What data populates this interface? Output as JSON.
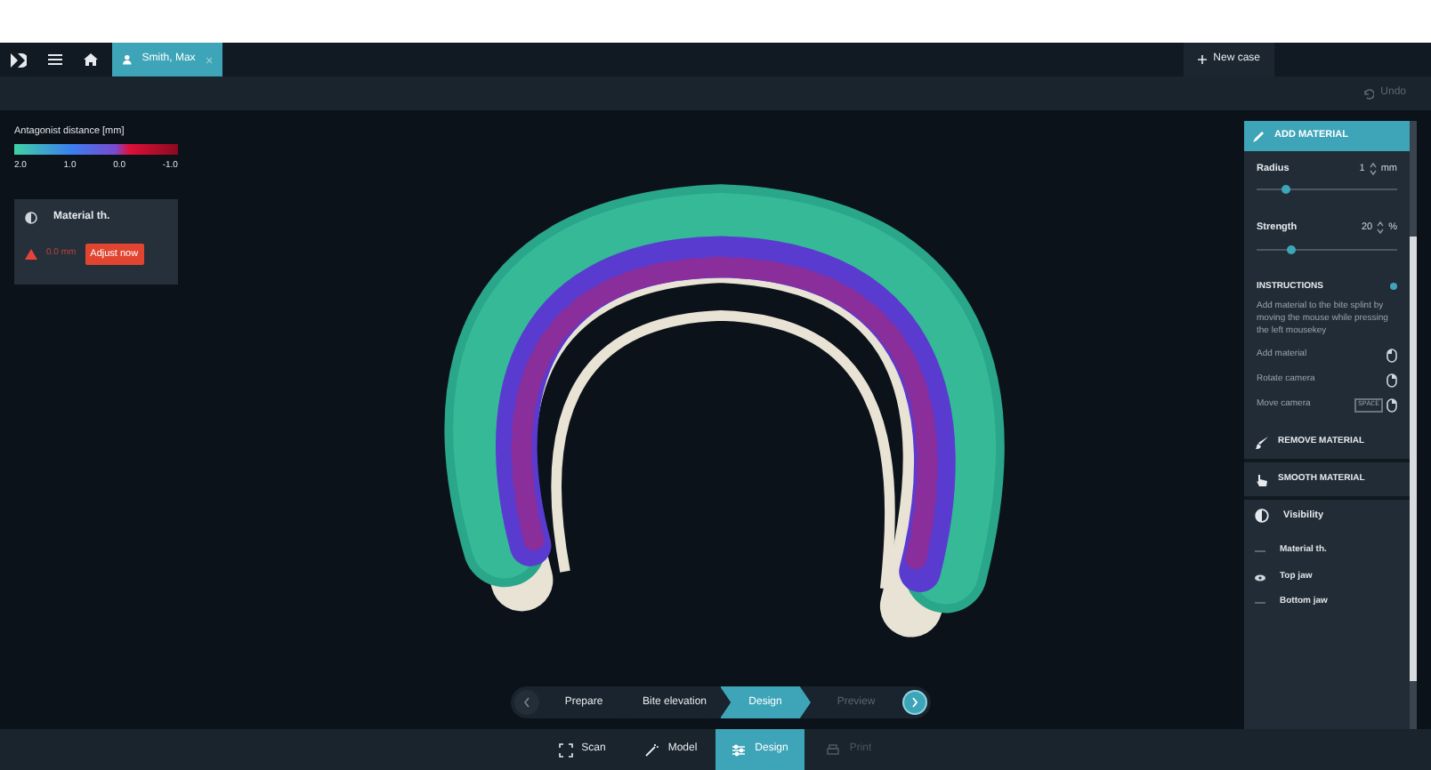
{
  "topbar": {
    "tabs": [
      {
        "label": "Smith, Max",
        "selected": true
      }
    ],
    "new_case": "New case"
  },
  "subbar": {
    "undo": {
      "label": "Undo",
      "disabled": true
    }
  },
  "legend": {
    "title": "Antagonist distance [mm]",
    "ticks": [
      "2.0",
      "1.0",
      "0.0",
      "-1.0"
    ]
  },
  "material_panel": {
    "title": "Material th.",
    "warning": "0.0 mm",
    "button": "Adjust now"
  },
  "tool_panel": {
    "add_material": {
      "title": "ADD MATERIAL",
      "expanded": true,
      "settings": [
        {
          "label": "Radius",
          "value": "1",
          "unit": "mm",
          "level": 0.18
        },
        {
          "label": "Strength",
          "value": "20",
          "unit": "%",
          "level": 0.22
        }
      ]
    },
    "instructions": {
      "title": "INSTRUCTIONS",
      "on": true,
      "text": "Add material to the bite splint by moving the mouse while pressing the left mousekey",
      "rows": [
        {
          "label": "Add material",
          "kind": "left"
        },
        {
          "label": "Rotate camera",
          "kind": "right"
        },
        {
          "label": "Move camera",
          "key": "SPACE",
          "kind": "right"
        }
      ]
    },
    "tools": [
      {
        "kind": "remove",
        "label": "REMOVE MATERIAL"
      },
      {
        "kind": "smooth",
        "label": "SMOOTH MATERIAL"
      }
    ],
    "visibility": {
      "title": "Visibility",
      "items": [
        {
          "label": "Material th.",
          "visible": false
        },
        {
          "label": "Top jaw",
          "visible": true
        },
        {
          "label": "Bottom jaw",
          "visible": false
        }
      ]
    }
  },
  "stepper": [
    {
      "label": "Prepare",
      "selected": false,
      "disabled": false
    },
    {
      "label": "Bite elevation",
      "selected": false,
      "disabled": false
    },
    {
      "label": "Design",
      "selected": true,
      "disabled": false
    },
    {
      "label": "Preview",
      "selected": false,
      "disabled": true
    }
  ],
  "bottom_tabs": [
    {
      "kind": "scan",
      "label": "Scan",
      "selected": false,
      "disabled": false
    },
    {
      "kind": "model",
      "label": "Model",
      "selected": false,
      "disabled": false
    },
    {
      "kind": "design",
      "label": "Design",
      "selected": true,
      "disabled": false
    },
    {
      "kind": "print",
      "label": "Print",
      "selected": false,
      "disabled": true
    }
  ]
}
